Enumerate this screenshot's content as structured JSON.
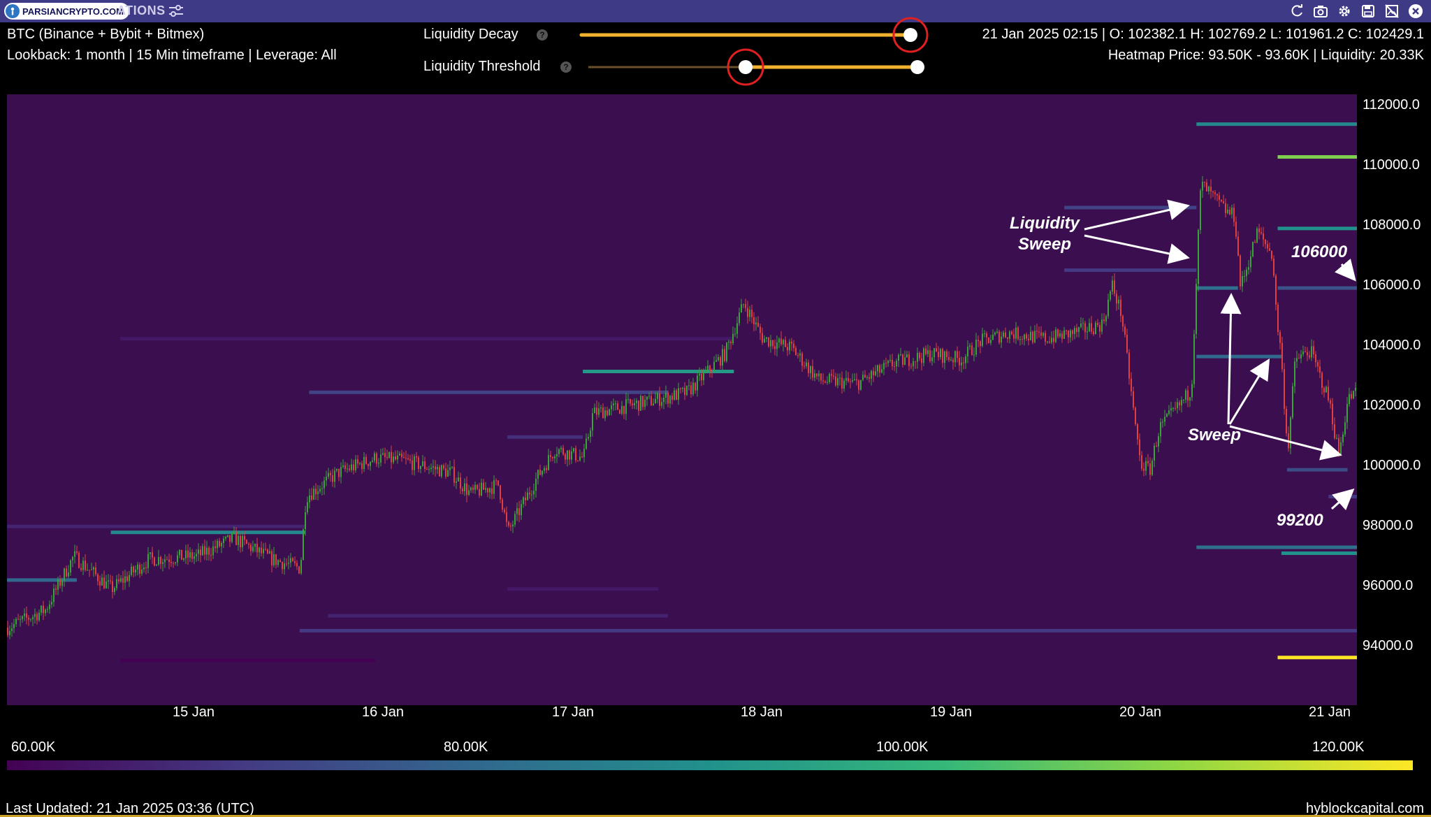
{
  "header": {
    "logo_text": "PARSIANCRYPTO.COM",
    "title_fragment": "ATIONS"
  },
  "toolbar_icons": [
    "refresh-icon",
    "camera-icon",
    "gear-icon",
    "save-icon",
    "no-image-icon",
    "close-icon"
  ],
  "info": {
    "exchange": "BTC (Binance + Bybit + Bitmex)",
    "lookback": "Lookback: 1 month | 15 Min timeframe | Leverage: All",
    "ohlc": "21 Jan 2025 02:15 | O: 102382.1 H: 102769.2 L: 101961.2 C: 102429.1",
    "heatmap": "Heatmap Price: 93.50K - 93.60K | Liquidity: 20.33K"
  },
  "controls": {
    "decay_label": "Liquidity Decay",
    "threshold_label": "Liquidity Threshold",
    "help_glyph": "?",
    "decay_value": 1.0,
    "threshold_range": [
      0.48,
      1.0
    ]
  },
  "colors": {
    "background": "#3b0f4f",
    "candle_up": "#3aa33a",
    "candle_down": "#e04040",
    "slider": "#f2b230",
    "highlight_circle": "#e02020",
    "colorbar_stops": [
      "#440154",
      "#443a83",
      "#31688e",
      "#21918c",
      "#35b779",
      "#90d743",
      "#fde725"
    ]
  },
  "chart_data": {
    "type": "heatmap",
    "title": "",
    "ylabel": "",
    "xlabel": "",
    "y_ticks": [
      "112000.0",
      "110000.0",
      "108000.0",
      "106000.0",
      "104000.0",
      "102000.0",
      "100000.0",
      "98000.0",
      "96000.0",
      "94000.0"
    ],
    "x_ticks": [
      "15 Jan",
      "16 Jan",
      "17 Jan",
      "18 Jan",
      "19 Jan",
      "20 Jan",
      "21 Jan"
    ],
    "colorbar_ticks": [
      "60.00K",
      "80.00K",
      "100.00K",
      "120.00K"
    ],
    "ylim": [
      92000,
      112500
    ],
    "xlim": [
      14.0,
      21.15
    ],
    "price_path": [
      [
        14.0,
        94600
      ],
      [
        14.2,
        95200
      ],
      [
        14.35,
        97000
      ],
      [
        14.55,
        95900
      ],
      [
        14.75,
        96900
      ],
      [
        15.0,
        97000
      ],
      [
        15.2,
        97600
      ],
      [
        15.4,
        96900
      ],
      [
        15.55,
        96600
      ],
      [
        15.58,
        99000
      ],
      [
        15.75,
        99800
      ],
      [
        15.95,
        100300
      ],
      [
        16.1,
        100200
      ],
      [
        16.35,
        99800
      ],
      [
        16.45,
        99100
      ],
      [
        16.6,
        99400
      ],
      [
        16.65,
        97800
      ],
      [
        16.8,
        99600
      ],
      [
        16.9,
        100600
      ],
      [
        17.05,
        100300
      ],
      [
        17.1,
        101800
      ],
      [
        17.4,
        102200
      ],
      [
        17.6,
        102500
      ],
      [
        17.8,
        103800
      ],
      [
        17.9,
        105500
      ],
      [
        18.0,
        104300
      ],
      [
        18.15,
        104000
      ],
      [
        18.3,
        102900
      ],
      [
        18.5,
        102800
      ],
      [
        18.7,
        103500
      ],
      [
        18.9,
        103800
      ],
      [
        19.05,
        103600
      ],
      [
        19.15,
        104200
      ],
      [
        19.3,
        104500
      ],
      [
        19.5,
        104300
      ],
      [
        19.65,
        104500
      ],
      [
        19.8,
        104800
      ],
      [
        19.85,
        106100
      ],
      [
        19.9,
        105100
      ],
      [
        19.97,
        101500
      ],
      [
        20.0,
        100100
      ],
      [
        20.05,
        99900
      ],
      [
        20.1,
        101300
      ],
      [
        20.2,
        102000
      ],
      [
        20.27,
        102600
      ],
      [
        20.3,
        107000
      ],
      [
        20.32,
        109500
      ],
      [
        20.45,
        108600
      ],
      [
        20.5,
        108400
      ],
      [
        20.53,
        106000
      ],
      [
        20.62,
        107900
      ],
      [
        20.7,
        107100
      ],
      [
        20.72,
        105000
      ],
      [
        20.74,
        104100
      ],
      [
        20.78,
        100500
      ],
      [
        20.82,
        103600
      ],
      [
        20.9,
        103900
      ],
      [
        21.0,
        102200
      ],
      [
        21.05,
        100400
      ],
      [
        21.1,
        102300
      ],
      [
        21.15,
        102500
      ]
    ],
    "liquidity_levels": [
      {
        "price": 111500,
        "x_start": 20.3,
        "x_end": 21.15,
        "intensity": 88
      },
      {
        "price": 110400,
        "x_start": 20.73,
        "x_end": 21.15,
        "intensity": 108
      },
      {
        "price": 108700,
        "x_start": 19.6,
        "x_end": 20.3,
        "intensity": 72
      },
      {
        "price": 108000,
        "x_start": 20.73,
        "x_end": 21.15,
        "intensity": 90
      },
      {
        "price": 106600,
        "x_start": 19.6,
        "x_end": 20.3,
        "intensity": 70
      },
      {
        "price": 106000,
        "x_start": 20.3,
        "x_end": 20.52,
        "intensity": 82
      },
      {
        "price": 106000,
        "x_start": 20.73,
        "x_end": 21.15,
        "intensity": 75
      },
      {
        "price": 104300,
        "x_start": 14.6,
        "x_end": 17.85,
        "intensity": 64
      },
      {
        "price": 103700,
        "x_start": 20.3,
        "x_end": 20.75,
        "intensity": 80
      },
      {
        "price": 103200,
        "x_start": 17.05,
        "x_end": 17.85,
        "intensity": 92
      },
      {
        "price": 102500,
        "x_start": 15.6,
        "x_end": 17.5,
        "intensity": 72
      },
      {
        "price": 101000,
        "x_start": 16.65,
        "x_end": 17.05,
        "intensity": 68
      },
      {
        "price": 99900,
        "x_start": 20.78,
        "x_end": 21.1,
        "intensity": 74
      },
      {
        "price": 99000,
        "x_start": 21.0,
        "x_end": 21.15,
        "intensity": 70
      },
      {
        "price": 98000,
        "x_start": 14.0,
        "x_end": 15.58,
        "intensity": 66
      },
      {
        "price": 97800,
        "x_start": 14.55,
        "x_end": 15.58,
        "intensity": 88
      },
      {
        "price": 97300,
        "x_start": 20.3,
        "x_end": 21.15,
        "intensity": 82
      },
      {
        "price": 97100,
        "x_start": 20.75,
        "x_end": 21.15,
        "intensity": 90
      },
      {
        "price": 96200,
        "x_start": 14.0,
        "x_end": 14.37,
        "intensity": 80
      },
      {
        "price": 95900,
        "x_start": 16.65,
        "x_end": 17.45,
        "intensity": 64
      },
      {
        "price": 95000,
        "x_start": 15.7,
        "x_end": 17.5,
        "intensity": 66
      },
      {
        "price": 94500,
        "x_start": 15.55,
        "x_end": 21.15,
        "intensity": 70
      },
      {
        "price": 93600,
        "x_start": 20.73,
        "x_end": 21.15,
        "intensity": 120
      },
      {
        "price": 93500,
        "x_start": 14.6,
        "x_end": 15.95,
        "intensity": 60
      }
    ],
    "annotations": [
      {
        "text": "Liquidity Sweep",
        "lines": [
          "Liquidity",
          "Sweep"
        ]
      },
      {
        "text": "106000"
      },
      {
        "text": "Sweep"
      },
      {
        "text": "99200"
      }
    ]
  },
  "footer": {
    "last_updated": "Last Updated: 21 Jan 2025 03:36 (UTC)",
    "brand": "hyblockcapital.com"
  }
}
